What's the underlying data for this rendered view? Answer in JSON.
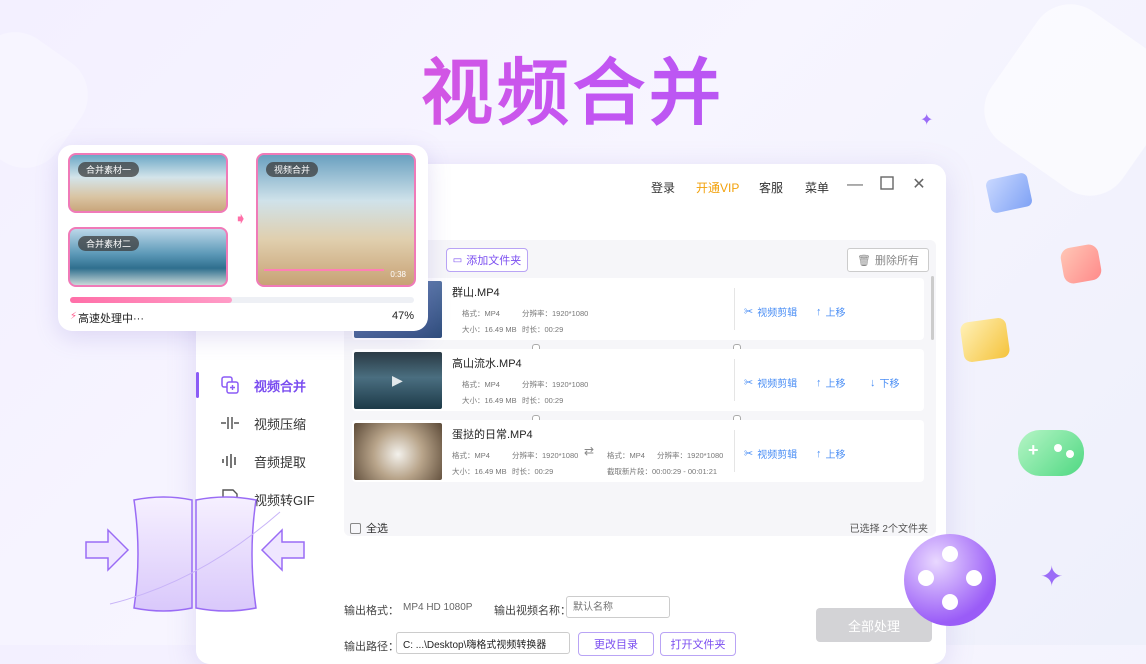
{
  "hero": {
    "title": "视频合并"
  },
  "titlebar": {
    "login": "登录",
    "vip": "开通VIP",
    "service": "客服",
    "menu": "菜单"
  },
  "sidebar": {
    "items": [
      {
        "label": "视频合并",
        "icon": "merge-icon",
        "active": true
      },
      {
        "label": "视频压缩",
        "icon": "compress-icon"
      },
      {
        "label": "音频提取",
        "icon": "audio-extract-icon"
      },
      {
        "label": "视频转GIF",
        "icon": "gif-icon"
      }
    ]
  },
  "toolbar": {
    "add_folder": "添加文件夹",
    "delete_all": "删除所有"
  },
  "meta_labels": {
    "format": "格式：",
    "resolution": "分辨率：",
    "size": "大小：",
    "duration": "时长：",
    "segment": "截取新片段："
  },
  "files": [
    {
      "name": "群山.MP4",
      "format": "MP4",
      "resolution": "1920*1080",
      "size": "16.49 MB",
      "duration": "00:29",
      "actions": [
        "视频剪辑",
        "上移"
      ]
    },
    {
      "name": "高山流水.MP4",
      "format": "MP4",
      "resolution": "1920*1080",
      "size": "16.49 MB",
      "duration": "00:29",
      "actions": [
        "视频剪辑",
        "上移",
        "下移"
      ]
    },
    {
      "name": "蛋挞的日常.MP4",
      "format": "MP4",
      "resolution": "1920*1080",
      "size": "16.49 MB",
      "duration": "00:29",
      "out_format": "MP4",
      "out_resolution": "1920*1080",
      "segment": "00:00:29 - 00:01:21",
      "actions": [
        "视频剪辑",
        "上移"
      ]
    }
  ],
  "select_all": "全选",
  "selected_count": "已选择 2个文件夹",
  "output": {
    "format_label": "输出格式：",
    "format_value": "MP4 HD 1080P",
    "name_label": "输出视频名称：",
    "name_placeholder": "默认名称",
    "path_label": "输出路径：",
    "path_value": "C: ...\\Desktop\\嗨格式视频转换器",
    "change_dir": "更改目录",
    "open_folder": "打开文件夹",
    "process_all": "全部处理"
  },
  "preview": {
    "clip1": "合并素材一",
    "clip2": "合并素材二",
    "merged": "视频合并",
    "merged_time": "0:38",
    "status": "高速处理中···",
    "percent": "47%",
    "progress": 0.47
  },
  "colors": {
    "accent": "#8b5cf6",
    "link": "#4a8ef5",
    "vip": "#f2a10b",
    "progress": "#ff6fa8"
  }
}
